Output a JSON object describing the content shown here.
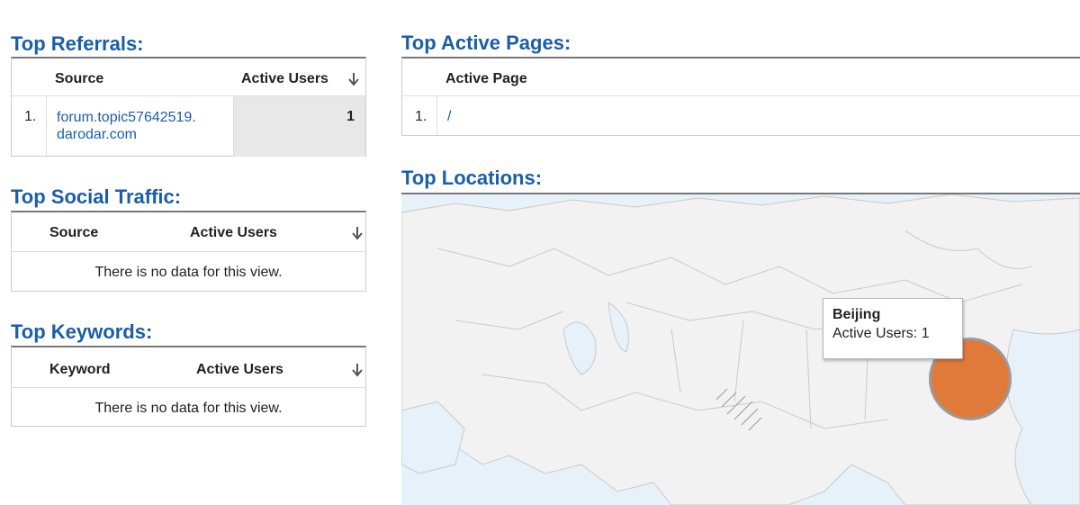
{
  "referrals": {
    "title": "Top Referrals:",
    "col_source": "Source",
    "col_users": "Active Users",
    "rows": [
      {
        "index": "1.",
        "source_line1": "forum.topic57642519.",
        "source_line2": "darodar.com",
        "users": "1"
      }
    ]
  },
  "social": {
    "title": "Top Social Traffic:",
    "col_source": "Source",
    "col_users": "Active Users",
    "empty": "There is no data for this view."
  },
  "keywords": {
    "title": "Top Keywords:",
    "col_keyword": "Keyword",
    "col_users": "Active Users",
    "empty": "There is no data for this view."
  },
  "pages": {
    "title": "Top Active Pages:",
    "col_page": "Active Page",
    "rows": [
      {
        "index": "1.",
        "page": "/"
      }
    ]
  },
  "locations": {
    "title": "Top Locations:",
    "tooltip": {
      "city": "Beijing",
      "users_text": "Active Users: 1"
    },
    "marker_color": "#e07a3a"
  },
  "icons": {
    "sort": "sort-down-arrow-icon"
  },
  "colors": {
    "accent": "#1a5ea8",
    "map_bg": "#e6f1f9",
    "land": "#f2f2f2"
  }
}
